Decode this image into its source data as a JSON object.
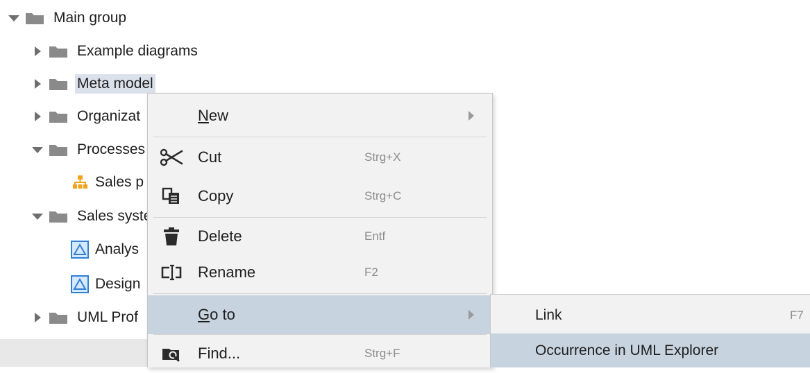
{
  "tree": {
    "items": [
      {
        "label": "Main group",
        "expanded": true,
        "icon": "folder-icon"
      },
      {
        "label": "Example diagrams",
        "expanded": false,
        "icon": "folder-icon"
      },
      {
        "label": "Meta model",
        "expanded": false,
        "icon": "folder-icon",
        "selected": true
      },
      {
        "label": "Organizat",
        "expanded": false,
        "icon": "folder-icon"
      },
      {
        "label": "Processes",
        "expanded": true,
        "icon": "folder-icon"
      },
      {
        "label": "Sales p",
        "icon": "process-diagram-icon"
      },
      {
        "label": "Sales syste",
        "expanded": true,
        "icon": "folder-icon"
      },
      {
        "label": "Analys",
        "icon": "uml-model-icon"
      },
      {
        "label": "Design",
        "icon": "uml-model-icon"
      },
      {
        "label": "UML Prof",
        "expanded": false,
        "icon": "folder-icon"
      }
    ]
  },
  "context_menu": {
    "items": [
      {
        "label": "New",
        "mnemonic": "N",
        "rest": "ew",
        "has_submenu": true
      },
      {
        "label": "Cut",
        "shortcut": "Strg+X",
        "icon": "scissors-icon"
      },
      {
        "label": "Copy",
        "shortcut": "Strg+C",
        "icon": "copy-icon"
      },
      {
        "label": "Delete",
        "shortcut": "Entf",
        "icon": "trash-icon"
      },
      {
        "label": "Rename",
        "shortcut": "F2",
        "icon": "rename-icon"
      },
      {
        "label": "Go to",
        "mnemonic": "G",
        "rest": "o to",
        "has_submenu": true,
        "active": true
      },
      {
        "label": "Find...",
        "shortcut": "Strg+F",
        "icon": "find-icon"
      }
    ]
  },
  "submenu": {
    "items": [
      {
        "label": "Link",
        "shortcut": "F7"
      },
      {
        "label": "Occurrence in UML Explorer",
        "active": true
      }
    ]
  },
  "colors": {
    "selection": "#dbe1ea",
    "menu_hover": "#c7d3df",
    "menu_bg": "#f2f2f2",
    "folder": "#8a8a8a",
    "uml_blue": "#2f7fd4",
    "diagram_orange": "#f0a41e"
  }
}
